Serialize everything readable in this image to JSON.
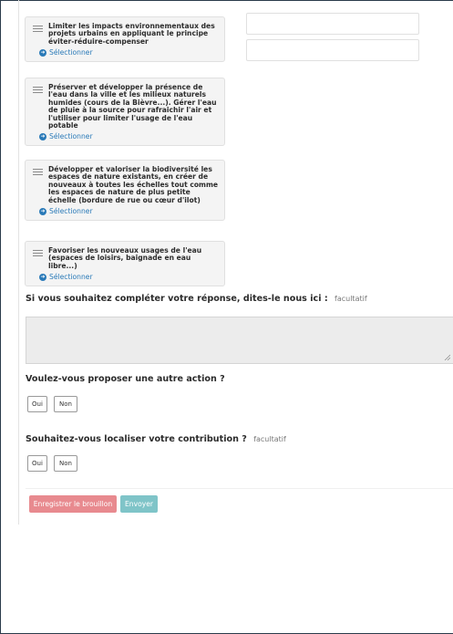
{
  "cards": [
    {
      "title": "Limiter les impacts environnementaux des projets urbains en appliquant le principe éviter-réduire-compenser",
      "select_label": "Sélectionner"
    },
    {
      "title": "Préserver et développer la présence de l'eau dans la ville et les milieux naturels humides (cours de la Bièvre...). Gérer l'eau de pluie à la source pour rafraichir l'air et l'utiliser pour limiter l'usage de l'eau potable",
      "select_label": "Sélectionner"
    },
    {
      "title": "Développer et valoriser la biodiversité les espaces de nature existants, en créer de nouveaux à toutes les échelles tout comme les espaces de nature de plus petite échelle (bordure de rue ou cœur d'ilot)",
      "select_label": "Sélectionner"
    },
    {
      "title": "Favoriser les nouveaux usages de l'eau (espaces de loisirs, baignade en eau libre...)",
      "select_label": "Sélectionner"
    }
  ],
  "q_complete": {
    "label": "Si vous souhaitez compléter votre réponse, dites-le nous ici :",
    "optional": "facultatif"
  },
  "q_other_action": {
    "label": "Voulez-vous proposer une autre action ?",
    "yes": "Oui",
    "no": "Non"
  },
  "q_localize": {
    "label": "Souhaitez-vous localiser votre contribution ?",
    "optional": "facultatif",
    "yes": "Oui",
    "no": "Non"
  },
  "actions": {
    "save_draft": "Enregistrer le brouillon",
    "send": "Envoyer"
  },
  "colors": {
    "accent_blue": "#2a7ab8",
    "draft_button": "#e88a8f",
    "send_button": "#7fc4c8"
  }
}
